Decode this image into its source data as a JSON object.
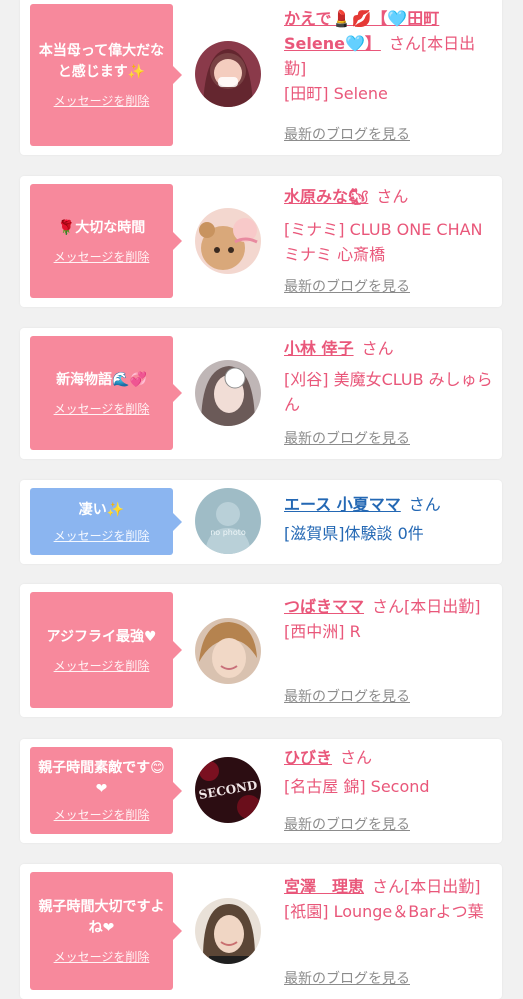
{
  "delete_label": "メッセージを削除",
  "blog_label": "最新のブログを見る",
  "san": "さん",
  "items": [
    {
      "message": "本当母って偉大だなと感じます✨",
      "name": "かえで💄💋【🩵田町Selene🩵】",
      "tag": "[本日出勤]",
      "shop": "[田町] Selene",
      "avatar_icon": "woman-photo-icon"
    },
    {
      "message": "🌹大切な時間",
      "name": "水原みな🐿",
      "tag": "",
      "shop": "[ミナミ] CLUB ONE CHAN ミナミ 心斎橋",
      "avatar_icon": "bear-photo-icon"
    },
    {
      "message": "新海物語🌊💞",
      "name": "小林 倖子",
      "tag": "",
      "shop": "[刈谷] 美魔女CLUB みしゅらん",
      "avatar_icon": "woman-photo-icon"
    },
    {
      "message": "凄い✨",
      "name": "エース 小夏ママ",
      "tag": "",
      "shop": "[滋賀県]体験談 0件",
      "avatar_icon": "no-photo-icon",
      "no_photo_text": "no photo"
    },
    {
      "message": "アジフライ最強♥",
      "name": "つばきママ",
      "tag": "[本日出勤]",
      "shop": "[西中洲] R",
      "avatar_icon": "woman-photo-icon"
    },
    {
      "message": "親子時間素敵です😊❤",
      "name": "ひびき",
      "tag": "",
      "shop": "[名古屋 錦] Second",
      "avatar_icon": "second-logo-icon",
      "avatar_text": "SECOND"
    },
    {
      "message": "親子時間大切ですよね❤",
      "name": "宮澤　理恵",
      "tag": "[本日出勤]",
      "shop": "[祇園] Lounge＆Barよつ葉",
      "avatar_icon": "woman-photo-icon"
    }
  ],
  "colors": {
    "bubble_pink": "#f7899c",
    "bubble_blue": "#8bb5f0",
    "name_pink": "#e9577a",
    "name_blue": "#2468b4",
    "link_gray": "#8c8c8c"
  }
}
